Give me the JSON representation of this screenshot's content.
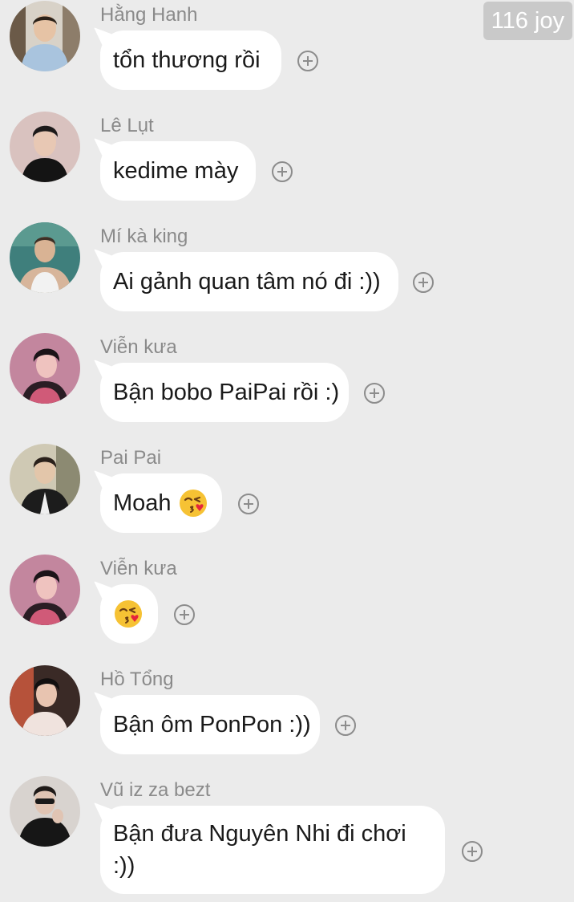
{
  "badge": {
    "text": "116 joy"
  },
  "messages": [
    {
      "sender": "Hằng Hanh",
      "text": "tổn thương rồi",
      "emoji": ""
    },
    {
      "sender": "Lê Lụt",
      "text": "kedime mày",
      "emoji": ""
    },
    {
      "sender": "Mí kà king",
      "text": "Ai gảnh quan tâm nó đi :))",
      "emoji": ""
    },
    {
      "sender": "Viễn kưa",
      "text": "Bận bobo PaiPai rồi :)",
      "emoji": ""
    },
    {
      "sender": "Pai Pai",
      "text": "Moah",
      "emoji": "face-blowing-a-kiss"
    },
    {
      "sender": "Viễn kưa",
      "text": "",
      "emoji": "face-blowing-a-kiss"
    },
    {
      "sender": "Hồ Tổng",
      "text": "Bận ôm PonPon :))",
      "emoji": ""
    },
    {
      "sender": "Vũ iz za bezt",
      "text": "Bận đưa Nguyên Nhi đi chơi :))",
      "emoji": ""
    }
  ],
  "icons": {
    "reaction": "add-reaction-icon",
    "avatar": "user-avatar"
  },
  "colors": {
    "background": "#ebebeb",
    "bubble": "#ffffff",
    "sender_name": "#8a8a8a",
    "message_text": "#1a1a1a",
    "badge_background": "#c9c9c9"
  }
}
